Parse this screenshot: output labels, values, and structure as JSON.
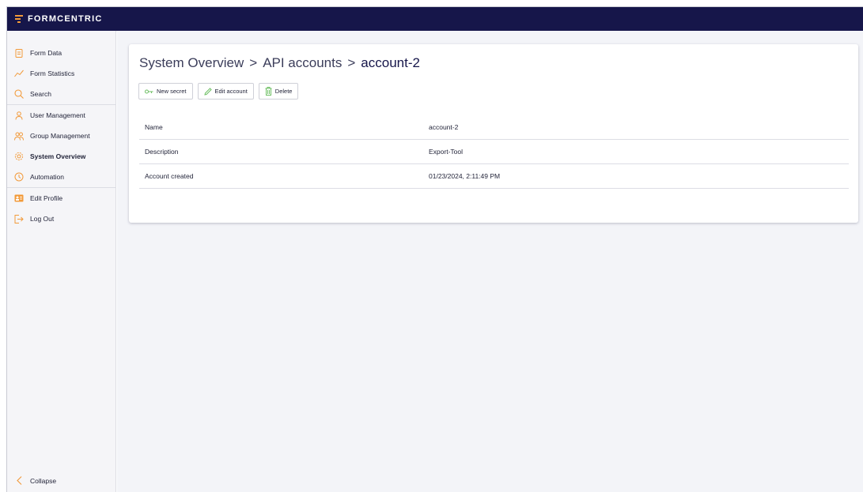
{
  "app": {
    "brand": "FORMCENTRIC"
  },
  "sidebar": {
    "groups": [
      [
        {
          "label": "Form Data",
          "icon": "form-icon"
        },
        {
          "label": "Form Statistics",
          "icon": "chart-icon"
        },
        {
          "label": "Search",
          "icon": "search-icon"
        }
      ],
      [
        {
          "label": "User Management",
          "icon": "user-icon"
        },
        {
          "label": "Group Management",
          "icon": "group-icon"
        },
        {
          "label": "System Overview",
          "icon": "gear-icon",
          "active": true
        },
        {
          "label": "Automation",
          "icon": "clock-icon"
        }
      ],
      [
        {
          "label": "Edit Profile",
          "icon": "profile-card-icon"
        },
        {
          "label": "Log Out",
          "icon": "logout-icon"
        }
      ]
    ],
    "collapse_label": "Collapse"
  },
  "breadcrumb": {
    "items": [
      "System Overview",
      "API accounts",
      "account-2"
    ],
    "separator": ">"
  },
  "actions": {
    "new_secret": "New secret",
    "edit_account": "Edit account",
    "delete": "Delete"
  },
  "details": {
    "rows": [
      {
        "label": "Name",
        "value": "account-2"
      },
      {
        "label": "Description",
        "value": "Export-Tool"
      },
      {
        "label": "Account created",
        "value": "01/23/2024, 2:11:49 PM"
      }
    ]
  },
  "colors": {
    "topbar": "#16164a",
    "accent": "#f29a3a",
    "action_icon": "#6dbf63"
  }
}
